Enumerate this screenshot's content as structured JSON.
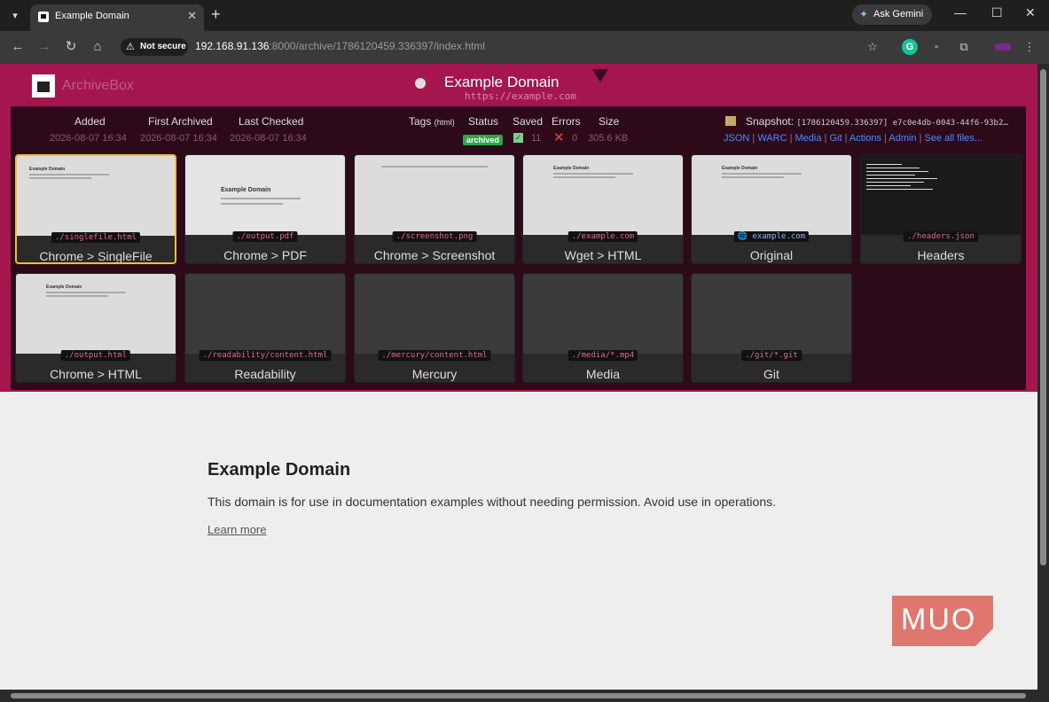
{
  "browser": {
    "tab_title": "Example Domain",
    "new_tab": "+",
    "gemini_label": "Ask Gemini",
    "security_label": "Not secure",
    "url_host": "192.168.91.136",
    "url_rest": ":8000/archive/1786120459.336397/index.html"
  },
  "archivebox": {
    "brand": "ArchiveBox",
    "page_title": "Example Domain",
    "page_url": "https://example.com",
    "headers": {
      "added": "Added",
      "first_archived": "First Archived",
      "last_checked": "Last Checked",
      "tags": "Tags",
      "tags_small": "(html)",
      "status": "Status",
      "saved": "Saved",
      "errors": "Errors",
      "size": "Size"
    },
    "values": {
      "added": "2026-08-07 16:34",
      "first_archived": "2026-08-07 16:34",
      "last_checked": "2026-08-07 16:34",
      "status": "archived",
      "saved": "11",
      "errors": "0",
      "size": "305.6 KB"
    },
    "snapshot_label": "Snapshot:",
    "snapshot_id": "[1786120459.336397] e7c0e4db-0043-44f6-93b2…",
    "links": [
      "JSON",
      "WARC",
      "Media",
      "Git",
      "Actions",
      "Admin",
      "See all files..."
    ]
  },
  "cards": [
    {
      "path": "./singlefile.html",
      "label": "Chrome > SingleFile"
    },
    {
      "path": "./output.pdf",
      "label": "Chrome > PDF"
    },
    {
      "path": "./screenshot.png",
      "label": "Chrome > Screenshot"
    },
    {
      "path": "./example.com",
      "label": "Wget > HTML"
    },
    {
      "path": "example.com",
      "label": "Original"
    },
    {
      "path": "./headers.json",
      "label": "Headers"
    },
    {
      "path": "./output.html",
      "label": "Chrome > HTML"
    },
    {
      "path": "./readability/content.html",
      "label": "Readability"
    },
    {
      "path": "./mercury/content.html",
      "label": "Mercury"
    },
    {
      "path": "./media/*.mp4",
      "label": "Media"
    },
    {
      "path": "./git/*.git",
      "label": "Git"
    }
  ],
  "content": {
    "heading": "Example Domain",
    "paragraph": "This domain is for use in documentation examples without needing permission. Avoid use in operations.",
    "link": "Learn more"
  },
  "watermark": "MUO"
}
